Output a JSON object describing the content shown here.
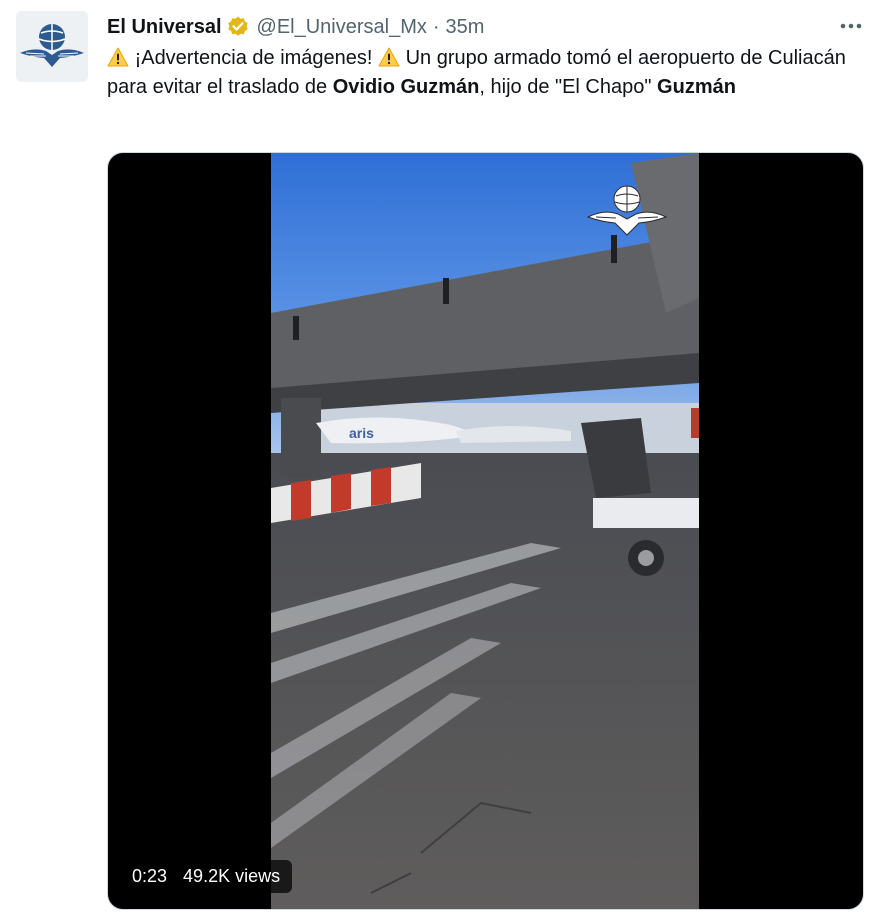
{
  "tweet": {
    "author_name": "El Universal",
    "handle": "@El_Universal_Mx",
    "separator": "·",
    "time": "35m",
    "verified": true,
    "text": {
      "part1": "¡Advertencia de imágenes!",
      "part2": "Un grupo armado tomó el aeropuerto de Culiacán para evitar el traslado de",
      "bold1": "Ovidio Guzmán",
      "part3": ", hijo de \"El Chapo\"",
      "bold2": "Guzmán"
    },
    "video": {
      "duration": "0:23",
      "views": "49.2K views",
      "airplane_text": "aris"
    }
  },
  "icons": {
    "avatar": "eagle-globe-logo",
    "verified": "verified-badge-icon",
    "more": "more-options-icon",
    "warning": "warning-emoji-icon"
  },
  "colors": {
    "text": "#0f1419",
    "secondary": "#536471",
    "verified": "#e2b719"
  }
}
